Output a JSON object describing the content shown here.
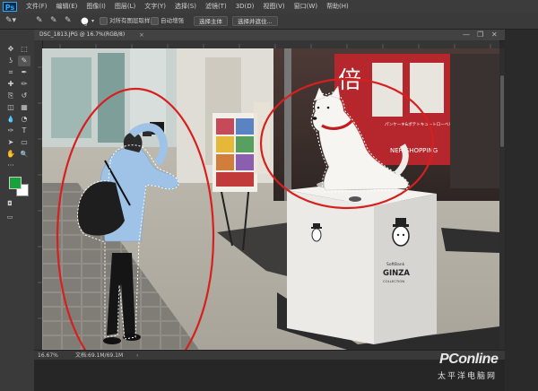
{
  "app": {
    "logo": "Ps"
  },
  "menubar": {
    "items": [
      "文件(F)",
      "编辑(E)",
      "图像(I)",
      "图层(L)",
      "文字(Y)",
      "选择(S)",
      "滤镜(T)",
      "3D(D)",
      "视图(V)",
      "窗口(W)",
      "帮助(H)"
    ]
  },
  "options": {
    "brush_size": "5",
    "sample_all_layers": "对所有图层取样",
    "auto_enhance": "自动增强",
    "select_subject": "选择主体",
    "select_and_mask": "选择并遮住..."
  },
  "tools": {
    "icons": [
      "move-icon",
      "marquee-icon",
      "lasso-icon",
      "quick-select-icon",
      "crop-icon",
      "eyedropper-icon",
      "spot-heal-icon",
      "brush-icon",
      "clone-stamp-icon",
      "history-brush-icon",
      "eraser-icon",
      "gradient-icon",
      "blur-icon",
      "dodge-icon",
      "pen-icon",
      "type-icon",
      "path-select-icon",
      "rectangle-icon",
      "hand-icon",
      "zoom-icon"
    ],
    "glyphs": [
      "✥",
      "⬚",
      "ʖ",
      "✎",
      "⌗",
      "✒",
      "✚",
      "✏",
      "⎘",
      "↺",
      "◫",
      "▦",
      "💧",
      "◔",
      "✑",
      "T",
      "➤",
      "▭",
      "✋",
      "🔍"
    ],
    "fg_color": "#18a33a",
    "bg_color": "#ffffff"
  },
  "document": {
    "tab_title": "DSC_1813.JPG @ 16.7%(RGB/8)",
    "close_glyph": "×",
    "minimize": "—",
    "restore": "❐",
    "close": "✕"
  },
  "photo": {
    "store_sign_big": "倍",
    "store_sign_side": "パンケーキ&ポテトキュートローベル",
    "store_sign_english": "NER SHOPPING",
    "box_brand_line1": "SoftBank",
    "box_brand_line2": "GINZA",
    "box_brand_line3": "COLLECTION"
  },
  "selection": {
    "marquee_color": "#ffffff",
    "ellipse_color": "#d62020"
  },
  "status": {
    "zoom": "16.67%",
    "doc": "文档:69.1M/69.1M",
    "arrow": "›"
  },
  "watermark": {
    "brand": "PConline",
    "sub": "太平洋电脑网"
  }
}
